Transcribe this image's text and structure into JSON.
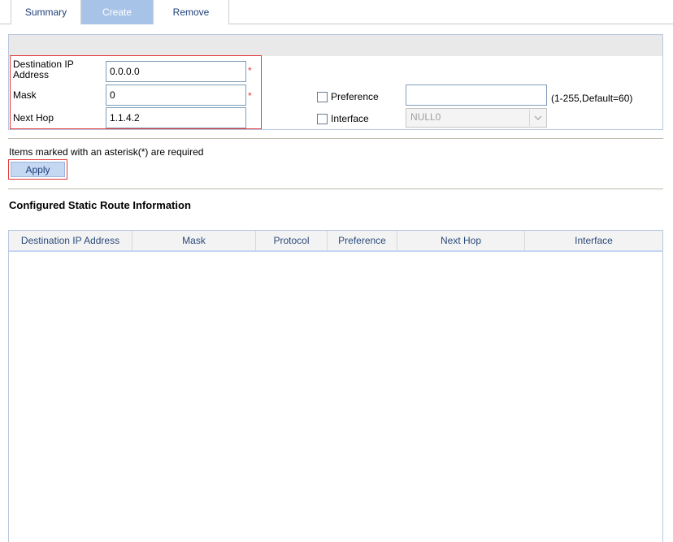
{
  "tabs": [
    {
      "label": "Summary",
      "active": false
    },
    {
      "label": "Create",
      "active": true
    },
    {
      "label": "Remove",
      "active": false
    }
  ],
  "form": {
    "destination_label": "Destination IP Address",
    "destination_value": "0.0.0.0",
    "mask_label": "Mask",
    "mask_value": "0",
    "nexthop_label": "Next Hop",
    "nexthop_value": "1.1.4.2",
    "required_mark": "*",
    "preference_label": "Preference",
    "preference_value": "",
    "preference_hint": "(1-255,Default=60)",
    "interface_label": "Interface",
    "interface_value": "NULL0"
  },
  "note": "Items marked with an asterisk(*) are required",
  "apply_label": "Apply",
  "section_title": "Configured Static Route Information",
  "table": {
    "columns": [
      "Destination IP Address",
      "Mask",
      "Protocol",
      "Preference",
      "Next Hop",
      "Interface"
    ],
    "rows": []
  },
  "colors": {
    "accent": "#a8c3e8",
    "highlight": "#e23a3a"
  },
  "icons": {
    "dropdown": "chevron-down-icon"
  }
}
